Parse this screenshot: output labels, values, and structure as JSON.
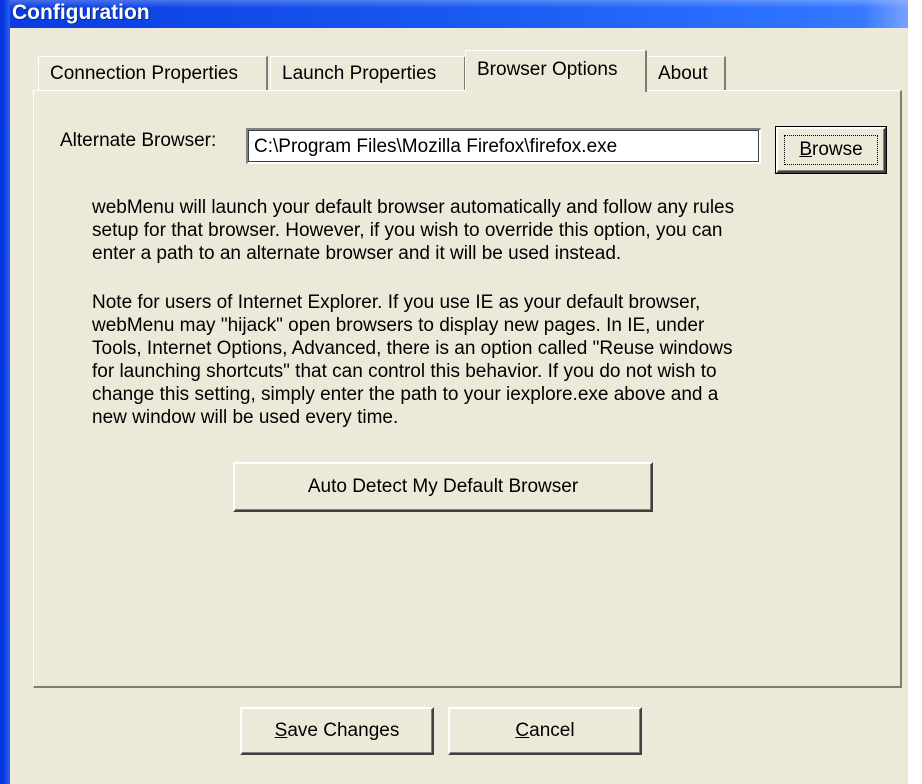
{
  "window": {
    "title": "Configuration"
  },
  "tabs": [
    {
      "label": "Connection Properties",
      "active": false
    },
    {
      "label": "Launch Properties",
      "active": false
    },
    {
      "label": "Browser Options",
      "active": true
    },
    {
      "label": "About",
      "active": false
    }
  ],
  "browser_options": {
    "alternate_browser_label": "Alternate Browser:",
    "alternate_browser_value": "C:\\Program Files\\Mozilla Firefox\\firefox.exe",
    "browse_button": {
      "mnemonic": "B",
      "rest": "rowse"
    },
    "paragraph1": "webMenu will launch your default browser automatically and follow any rules\nsetup for that browser.  However, if you wish to override this option, you can\nenter a path to an alternate browser and it will be used instead.",
    "paragraph2": "Note for users of Internet Explorer.  If you use IE as your default browser,\nwebMenu may \"hijack\" open browsers to display new pages.  In IE, under\nTools, Internet Options,  Advanced, there is an option called \"Reuse windows\nfor launching shortcuts\" that can control this behavior.  If you do not wish to\nchange this setting, simply enter the path to your iexplore.exe above and a\nnew window will be used every time.",
    "auto_detect_button": "Auto Detect My Default Browser"
  },
  "footer": {
    "save_button": {
      "mnemonic": "S",
      "rest": "ave Changes"
    },
    "cancel_button": {
      "mnemonic": "C",
      "rest": "ancel"
    }
  },
  "colors": {
    "titlebar": "#0a3be0",
    "face": "#ece9d8",
    "title_text": "#ffffff"
  }
}
